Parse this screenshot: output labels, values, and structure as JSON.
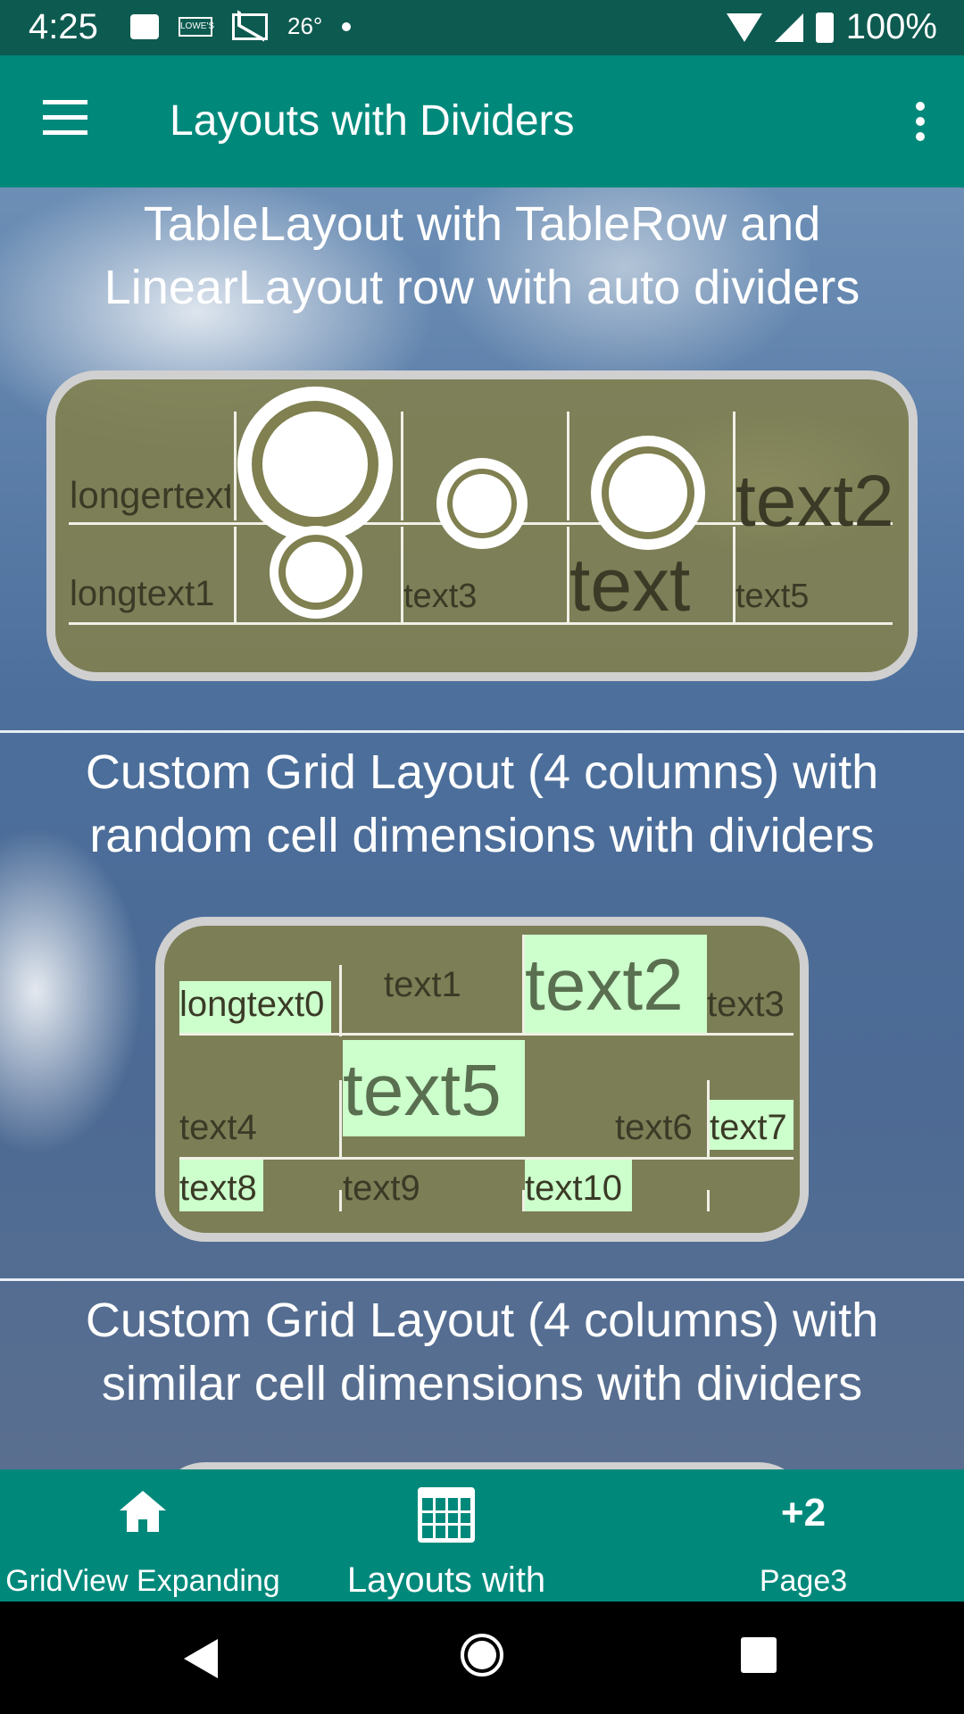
{
  "status_bar": {
    "time": "4:25",
    "temperature": "26°",
    "lowes_label": "LOWE'S",
    "battery": "100%",
    "icons": [
      "message-icon",
      "lowes-icon",
      "gmail-icon",
      "dot-icon",
      "wifi-icon",
      "signal-icon",
      "battery-icon"
    ]
  },
  "toolbar": {
    "title": "Layouts with Dividers",
    "menu_icon": "hamburger-menu-icon",
    "overflow_icon": "more-vert-icon",
    "color": "#00897b"
  },
  "sections": [
    {
      "title_line1": "TableLayout with TableRow and",
      "title_line2": "LinearLayout row with auto dividers",
      "row1": [
        "longertext",
        "text2"
      ],
      "row2": [
        "longtext1",
        "text3",
        "text",
        "text5"
      ]
    },
    {
      "title_line1": "Custom Grid Layout (4 columns) with",
      "title_line2": "random cell dimensions with dividers",
      "cells": [
        "longtext0",
        "text1",
        "text2",
        "text3",
        "text4",
        "text5",
        "text6",
        "text7",
        "text8",
        "text9",
        "text10"
      ]
    },
    {
      "title_line1": "Custom Grid Layout (4 columns) with",
      "title_line2": "similar cell dimensions with dividers"
    }
  ],
  "bottom_nav": {
    "items": [
      {
        "label": "GridView Expanding",
        "icon": "home-icon"
      },
      {
        "label": "Layouts with",
        "icon": "calendar-icon"
      },
      {
        "label": "Page3",
        "badge": "+2"
      }
    ]
  },
  "colors": {
    "panel": "#808050",
    "panel_border": "#d0d0d0",
    "cell_highlight": "#ccffcc"
  }
}
